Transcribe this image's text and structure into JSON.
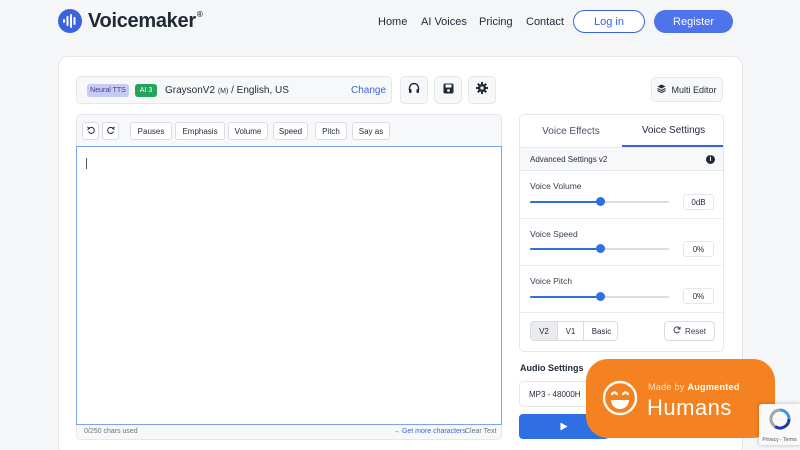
{
  "header": {
    "brand": "Voicemaker",
    "brand_mark": "®",
    "nav": [
      "Home",
      "AI Voices",
      "Pricing",
      "Contact"
    ],
    "login_label": "Log in",
    "register_label": "Register"
  },
  "voice": {
    "badge_neural": "Neural TTS",
    "badge_ai": "AI 3",
    "name": "GraysonV2",
    "gender": "(M)",
    "locale": "/ English, US",
    "change_label": "Change"
  },
  "toolbar_icons": [
    "headphones-icon",
    "save-icon",
    "gear-icon"
  ],
  "multi_editor_label": "Multi Editor",
  "editor": {
    "tools": [
      "Pauses",
      "Emphasis",
      "Volume",
      "Speed",
      "Pitch",
      "Say as"
    ],
    "chars_used": "0/250 chars used",
    "get_more": "→ Get more characters",
    "clear_text": "Clear Text"
  },
  "settings": {
    "tabs": [
      "Voice Effects",
      "Voice Settings"
    ],
    "active_tab": "Voice Settings",
    "advanced_label": "Advanced Settings v2",
    "sliders": [
      {
        "label": "Voice Volume",
        "value": "0dB",
        "level": 0.5
      },
      {
        "label": "Voice Speed",
        "value": "0%",
        "level": 0.5
      },
      {
        "label": "Voice Pitch",
        "value": "0%",
        "level": 0.5
      }
    ],
    "versions": [
      "V2",
      "V1",
      "Basic"
    ],
    "active_version": "V2",
    "reset_label": "Reset"
  },
  "audio": {
    "label": "Audio Settings",
    "format": "MP3 - 48000H"
  },
  "overlay": {
    "made_by": "Made by",
    "augmented": "Augmented",
    "humans": "Humans"
  },
  "recaptcha": {
    "text": "Privacy - Terms"
  },
  "colors": {
    "accent": "#3b63e0",
    "slider": "#2f6fe4",
    "overlay": "#f58220",
    "badge_ai": "#22a45a"
  }
}
